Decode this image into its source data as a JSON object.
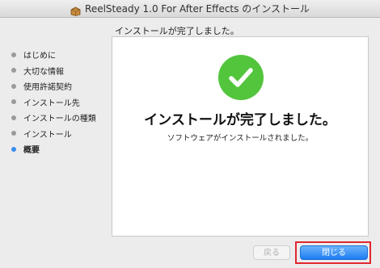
{
  "window": {
    "title": "ReelSteady 1.0 For After Effects のインストール"
  },
  "header": {
    "text": "インストールが完了しました。"
  },
  "sidebar": {
    "items": [
      {
        "label": "はじめに"
      },
      {
        "label": "大切な情報"
      },
      {
        "label": "使用許諾契約"
      },
      {
        "label": "インストール先"
      },
      {
        "label": "インストールの種類"
      },
      {
        "label": "インストール"
      },
      {
        "label": "概要",
        "active": true
      }
    ]
  },
  "main": {
    "heading": "インストールが完了しました。",
    "message": "ソフトウェアがインストールされました。",
    "icon": "checkmark-circle-icon",
    "icon_color": "#52c53c"
  },
  "buttons": {
    "back_label": "戻る",
    "close_label": "閉じる"
  },
  "colors": {
    "accent": "#1d7df2",
    "active_step": "#3b8ef0",
    "highlight": "#e0282f"
  }
}
